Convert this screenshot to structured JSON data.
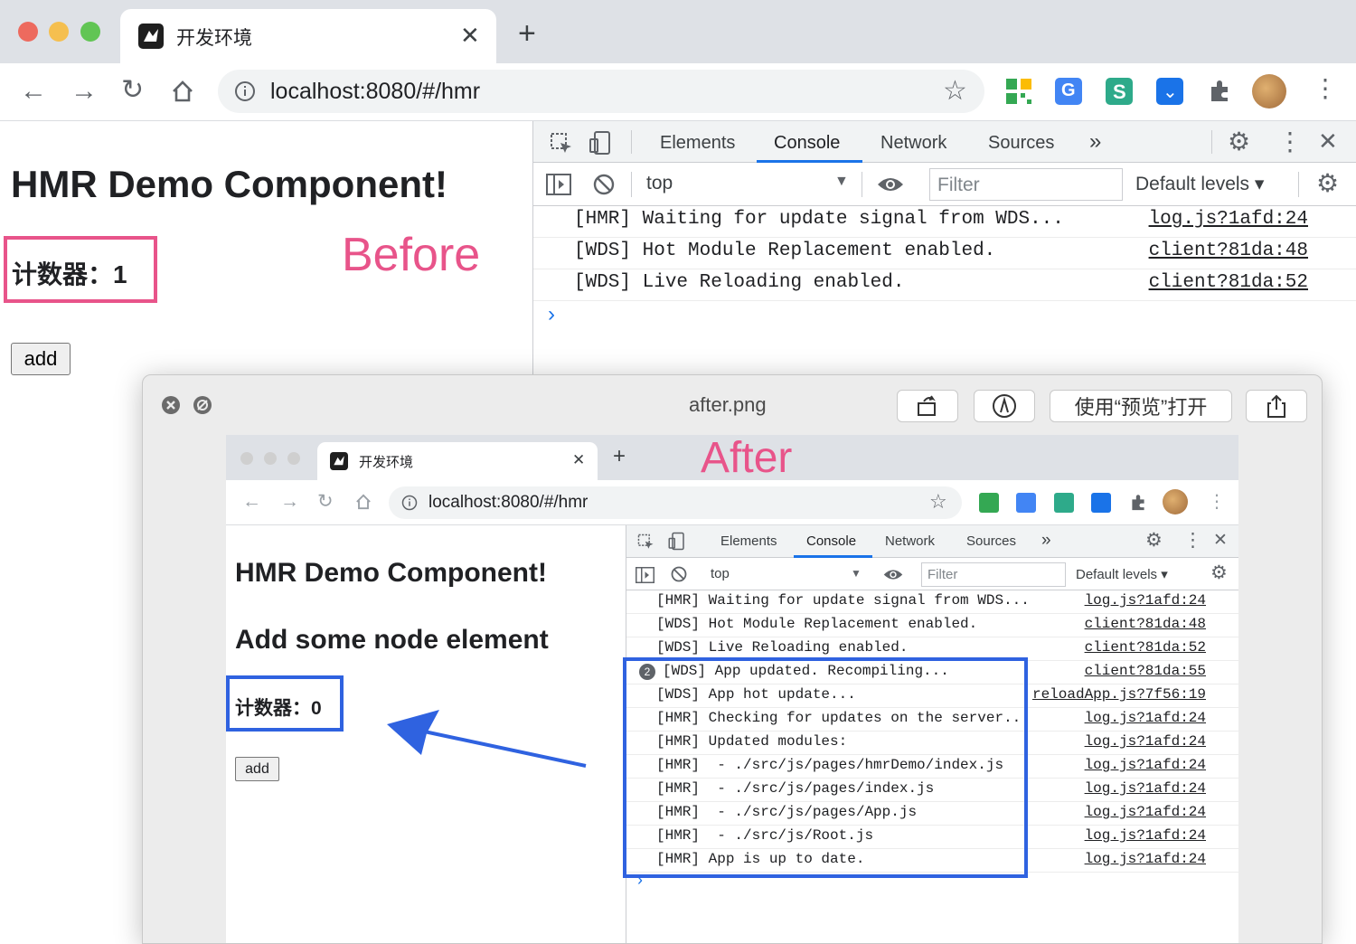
{
  "browser": {
    "tab_title": "开发环境",
    "new_tab_icon": "plus-icon",
    "url": "localhost:8080/#/hmr"
  },
  "page": {
    "heading": "HMR Demo Component!",
    "counter_label": "计数器：1",
    "add_button": "add",
    "before_annotation": "Before"
  },
  "devtools": {
    "tabs": [
      "Elements",
      "Console",
      "Network",
      "Sources"
    ],
    "active_tab": "Console",
    "context": "top",
    "filter_placeholder": "Filter",
    "levels": "Default levels ▾",
    "logs": [
      {
        "msg": "[HMR] Waiting for update signal from WDS...",
        "src": "log.js?1afd:24"
      },
      {
        "msg": "[WDS] Hot Module Replacement enabled.",
        "src": "client?81da:48"
      },
      {
        "msg": "[WDS] Live Reloading enabled.",
        "src": "client?81da:52"
      }
    ],
    "prompt": "›"
  },
  "preview": {
    "title": "after.png",
    "open_in_preview": "使用“预览”打开"
  },
  "after": {
    "annotation": "After",
    "tab_title": "开发环境",
    "url": "localhost:8080/#/hmr",
    "heading": "HMR Demo Component!",
    "subheading": "Add some node element",
    "counter_label": "计数器：0",
    "add_button": "add",
    "devtools": {
      "tabs": [
        "Elements",
        "Console",
        "Network",
        "Sources"
      ],
      "context": "top",
      "filter_placeholder": "Filter",
      "levels": "Default levels ▾",
      "repeat_badge": "2",
      "logs": [
        {
          "msg": "[HMR] Waiting for update signal from WDS...",
          "src": "log.js?1afd:24"
        },
        {
          "msg": "[WDS] Hot Module Replacement enabled.",
          "src": "client?81da:48"
        },
        {
          "msg": "[WDS] Live Reloading enabled.",
          "src": "client?81da:52"
        },
        {
          "msg": "[WDS] App updated. Recompiling...",
          "src": "client?81da:55"
        },
        {
          "msg": "[WDS] App hot update...",
          "src": "reloadApp.js?7f56:19"
        },
        {
          "msg": "[HMR] Checking for updates on the server...",
          "src": "log.js?1afd:24"
        },
        {
          "msg": "[HMR] Updated modules:",
          "src": "log.js?1afd:24"
        },
        {
          "msg": "[HMR]  - ./src/js/pages/hmrDemo/index.js",
          "src": "log.js?1afd:24"
        },
        {
          "msg": "[HMR]  - ./src/js/pages/index.js",
          "src": "log.js?1afd:24"
        },
        {
          "msg": "[HMR]  - ./src/js/pages/App.js",
          "src": "log.js?1afd:24"
        },
        {
          "msg": "[HMR]  - ./src/js/Root.js",
          "src": "log.js?1afd:24"
        },
        {
          "msg": "[HMR] App is up to date.",
          "src": "log.js?1afd:24"
        }
      ]
    }
  },
  "colors": {
    "pink": "#e8548a",
    "blue": "#2f62e0"
  }
}
